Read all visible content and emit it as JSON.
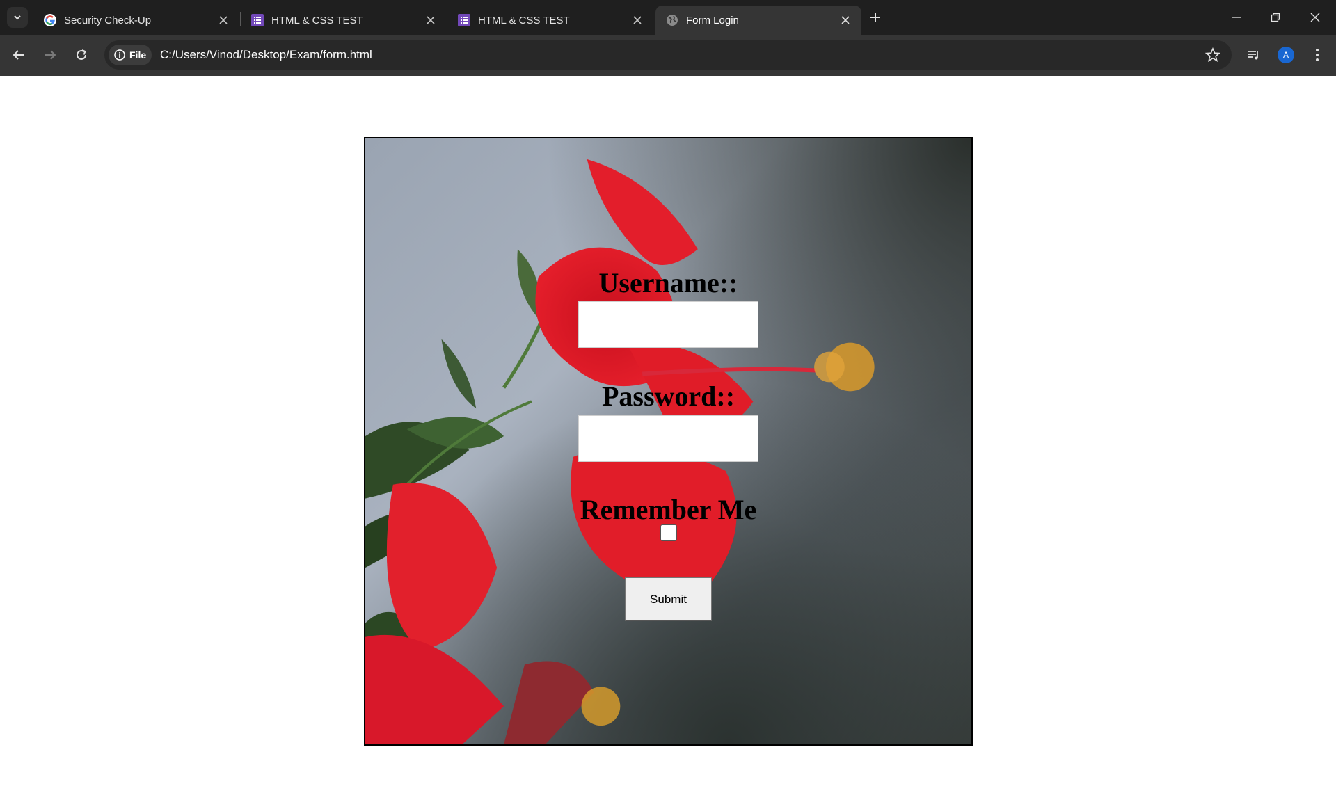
{
  "browser": {
    "tabs": [
      {
        "title": "Security Check-Up",
        "icon": "google-g-icon",
        "active": false
      },
      {
        "title": "HTML & CSS TEST",
        "icon": "forms-icon",
        "active": false
      },
      {
        "title": "HTML & CSS TEST",
        "icon": "forms-icon",
        "active": false
      },
      {
        "title": "Form Login",
        "icon": "globe-icon",
        "active": true
      }
    ],
    "address": {
      "scheme_chip": "File",
      "url": "C:/Users/Vinod/Desktop/Exam/form.html"
    },
    "profile_initial": "A",
    "colors": {
      "tabstrip": "#1f1f1f",
      "toolbar": "#353535",
      "omnibox": "#282828",
      "profile": "#1967d2"
    }
  },
  "form": {
    "username_label": "Username::",
    "username_value": "",
    "password_label": "Password::",
    "password_value": "",
    "remember_label": "Remember Me",
    "remember_checked": false,
    "submit_label": "Submit"
  }
}
